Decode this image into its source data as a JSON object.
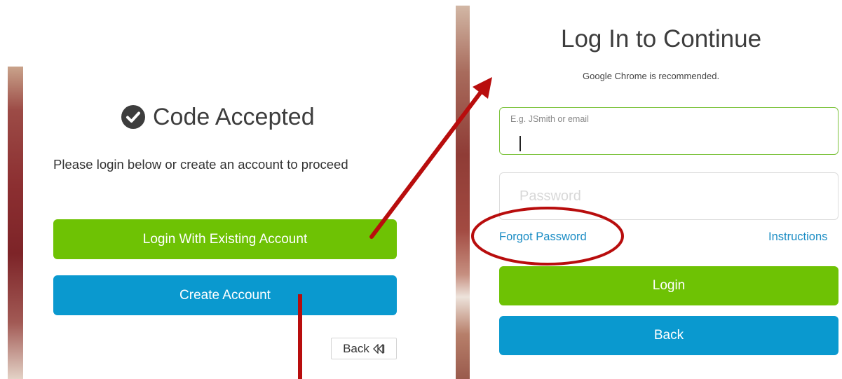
{
  "left": {
    "title": "Code Accepted",
    "icon": "check-circle-icon",
    "subtitle": "Please login below or create an account to proceed",
    "login_existing_label": "Login With Existing Account",
    "create_account_label": "Create Account",
    "back_label": "Back",
    "back_icon": "rewind-icon"
  },
  "right": {
    "title": "Log In to Continue",
    "note": "Google Chrome is recommended.",
    "username_placeholder": "E.g. JSmith or email",
    "password_placeholder": "Password",
    "forgot_label": "Forgot Password",
    "instructions_label": "Instructions",
    "login_label": "Login",
    "back_label": "Back"
  },
  "colors": {
    "green": "#6ec204",
    "blue": "#0a99cf",
    "link": "#1a8cc4",
    "annotation_red": "#b80d0d"
  }
}
